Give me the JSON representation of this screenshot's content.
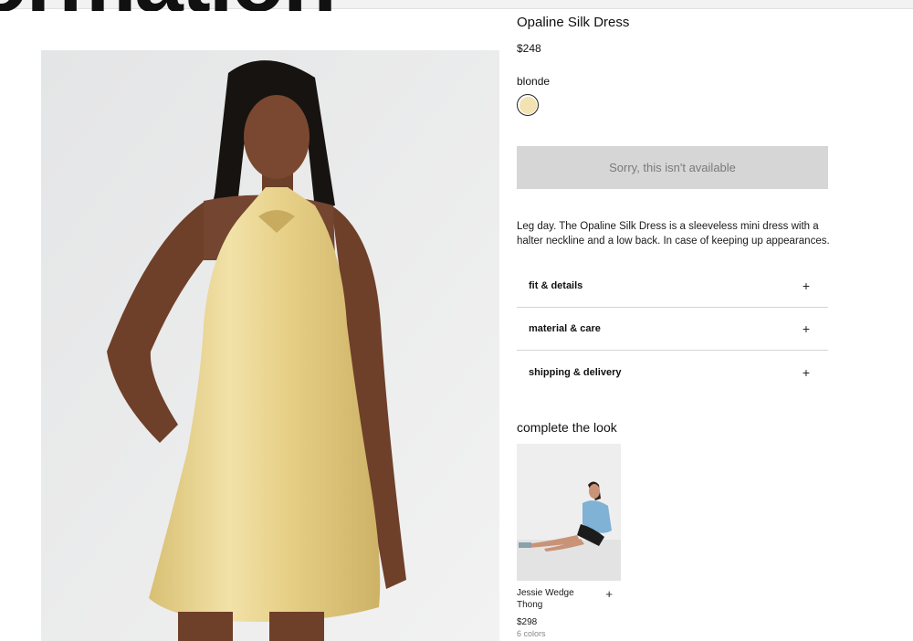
{
  "hero": {
    "word": "ormation"
  },
  "product": {
    "name": "Opaline Silk Dress",
    "price": "$248",
    "color_name": "blonde",
    "swatch_color": "#f3e3b3",
    "status_button": "Sorry, this isn't available",
    "description": "Leg day. The Opaline Silk Dress is a sleeveless mini dress with a halter neckline and a low back. In case of keeping up appearances."
  },
  "accordion": [
    {
      "label": "fit & details",
      "icon": "+"
    },
    {
      "label": "material & care",
      "icon": "+"
    },
    {
      "label": "shipping & delivery",
      "icon": "+"
    }
  ],
  "complete_the_look": {
    "heading": "complete the look",
    "items": [
      {
        "name": "Jessie Wedge Thong",
        "price": "$298",
        "colors": "6 colors",
        "add_icon": "+"
      }
    ]
  },
  "colors": {
    "dress": "#e8d394",
    "background": "#e9eaea",
    "unavailable_bg": "#d6d6d6"
  }
}
